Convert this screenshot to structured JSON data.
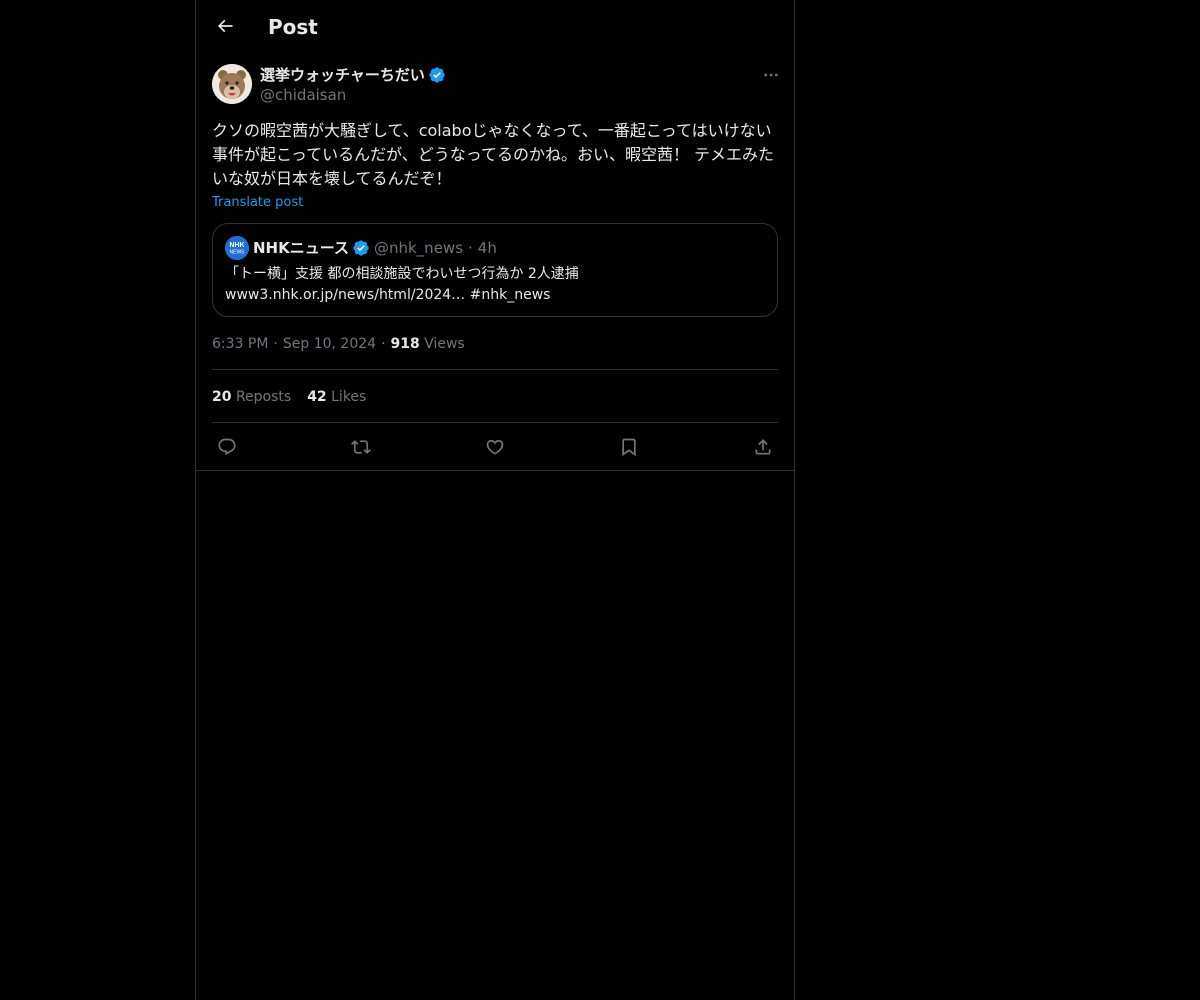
{
  "header": {
    "back_icon": "arrow-left-icon",
    "title": "Post"
  },
  "post": {
    "author": {
      "name": "選挙ウォッチャーちだい",
      "handle": "@chidaisan",
      "verified": true,
      "avatar_icon": "bear-avatar"
    },
    "more_icon": "more-horizontal-icon",
    "text": "クソの暇空茜が大騒ぎして、colaboじゃなくなって、一番起こってはいけない事件が起こっているんだが、どうなってるのかね。おい、暇空茜！ テメエみたいな奴が日本を壊してるんだぞ！",
    "translate_label": "Translate post",
    "quote": {
      "logo_text_top": "NHK",
      "logo_text_bottom": "NEWS",
      "author_name": "NHKニュース",
      "author_handle": "@nhk_news",
      "dot": "·",
      "time": "4h",
      "line1": "「トー横」支援 都の相談施設でわいせつ行為か 2人逮捕",
      "line2": "www3.nhk.or.jp/news/html/2024… #nhk_news"
    },
    "meta": {
      "time": "6:33 PM",
      "sep": "·",
      "date": "Sep 10, 2024",
      "views_count": "918",
      "views_label": "Views"
    },
    "stats": {
      "reposts_count": "20",
      "reposts_label": "Reposts",
      "likes_count": "42",
      "likes_label": "Likes"
    },
    "actions": [
      "reply-icon",
      "repost-icon",
      "like-icon",
      "bookmark-icon",
      "share-icon"
    ]
  },
  "colors": {
    "background": "#000000",
    "text": "#e7e9ea",
    "muted": "#71767b",
    "accent": "#1d9bf0",
    "border": "#2f3336"
  }
}
